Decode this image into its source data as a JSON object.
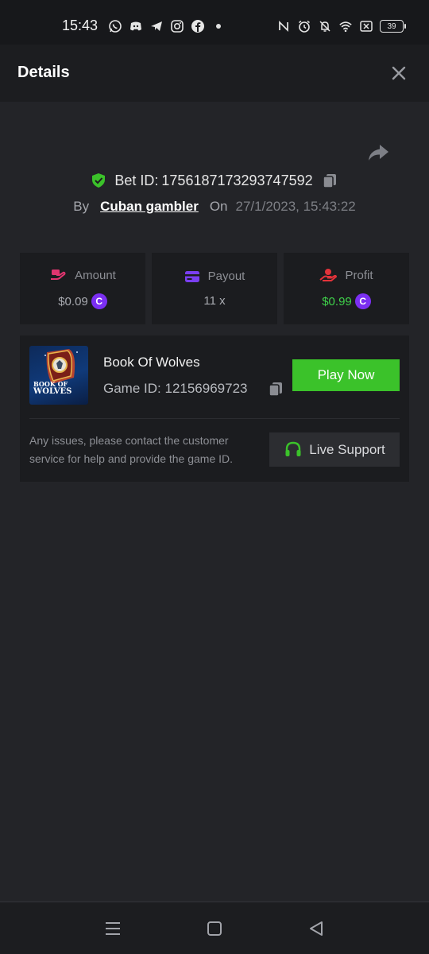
{
  "status_bar": {
    "time": "15:43",
    "battery": "39"
  },
  "header": {
    "title": "Details"
  },
  "bet": {
    "label": "Bet ID:",
    "id": "1756187173293747592"
  },
  "by": {
    "by_label": "By",
    "user": "Cuban gambler",
    "on_label": "On",
    "date": "27/1/2023, 15:43:22"
  },
  "stats": {
    "amount_label": "Amount",
    "amount_value": "$0.09",
    "payout_label": "Payout",
    "payout_value": "11 x",
    "profit_label": "Profit",
    "profit_value": "$0.99",
    "coin_symbol": "C"
  },
  "game": {
    "name": "Book Of Wolves",
    "id_label": "Game ID:",
    "id": "12156969723",
    "play_label": "Play Now",
    "thumb_text_line1": "BOOK OF",
    "thumb_text_line2": "WOLVES"
  },
  "support": {
    "text": "Any issues, please contact the customer service for help and provide the game ID.",
    "button_label": "Live Support"
  },
  "colors": {
    "accent_green": "#3bc22a",
    "profit_green": "#3fd14a",
    "coin_purple": "#7b2ff2",
    "amount_pink": "#e0356f",
    "payout_purple": "#7a3ff0",
    "profit_red": "#e2333a"
  },
  "icons": [
    "whatsapp-icon",
    "discord-icon",
    "telegram-icon",
    "instagram-icon",
    "facebook-icon",
    "nfc-icon",
    "alarm-icon",
    "mute-icon",
    "wifi-icon",
    "close-icon",
    "share-icon",
    "shield-check-icon",
    "copy-icon",
    "headset-icon",
    "menu-icon",
    "home-icon",
    "back-icon"
  ]
}
